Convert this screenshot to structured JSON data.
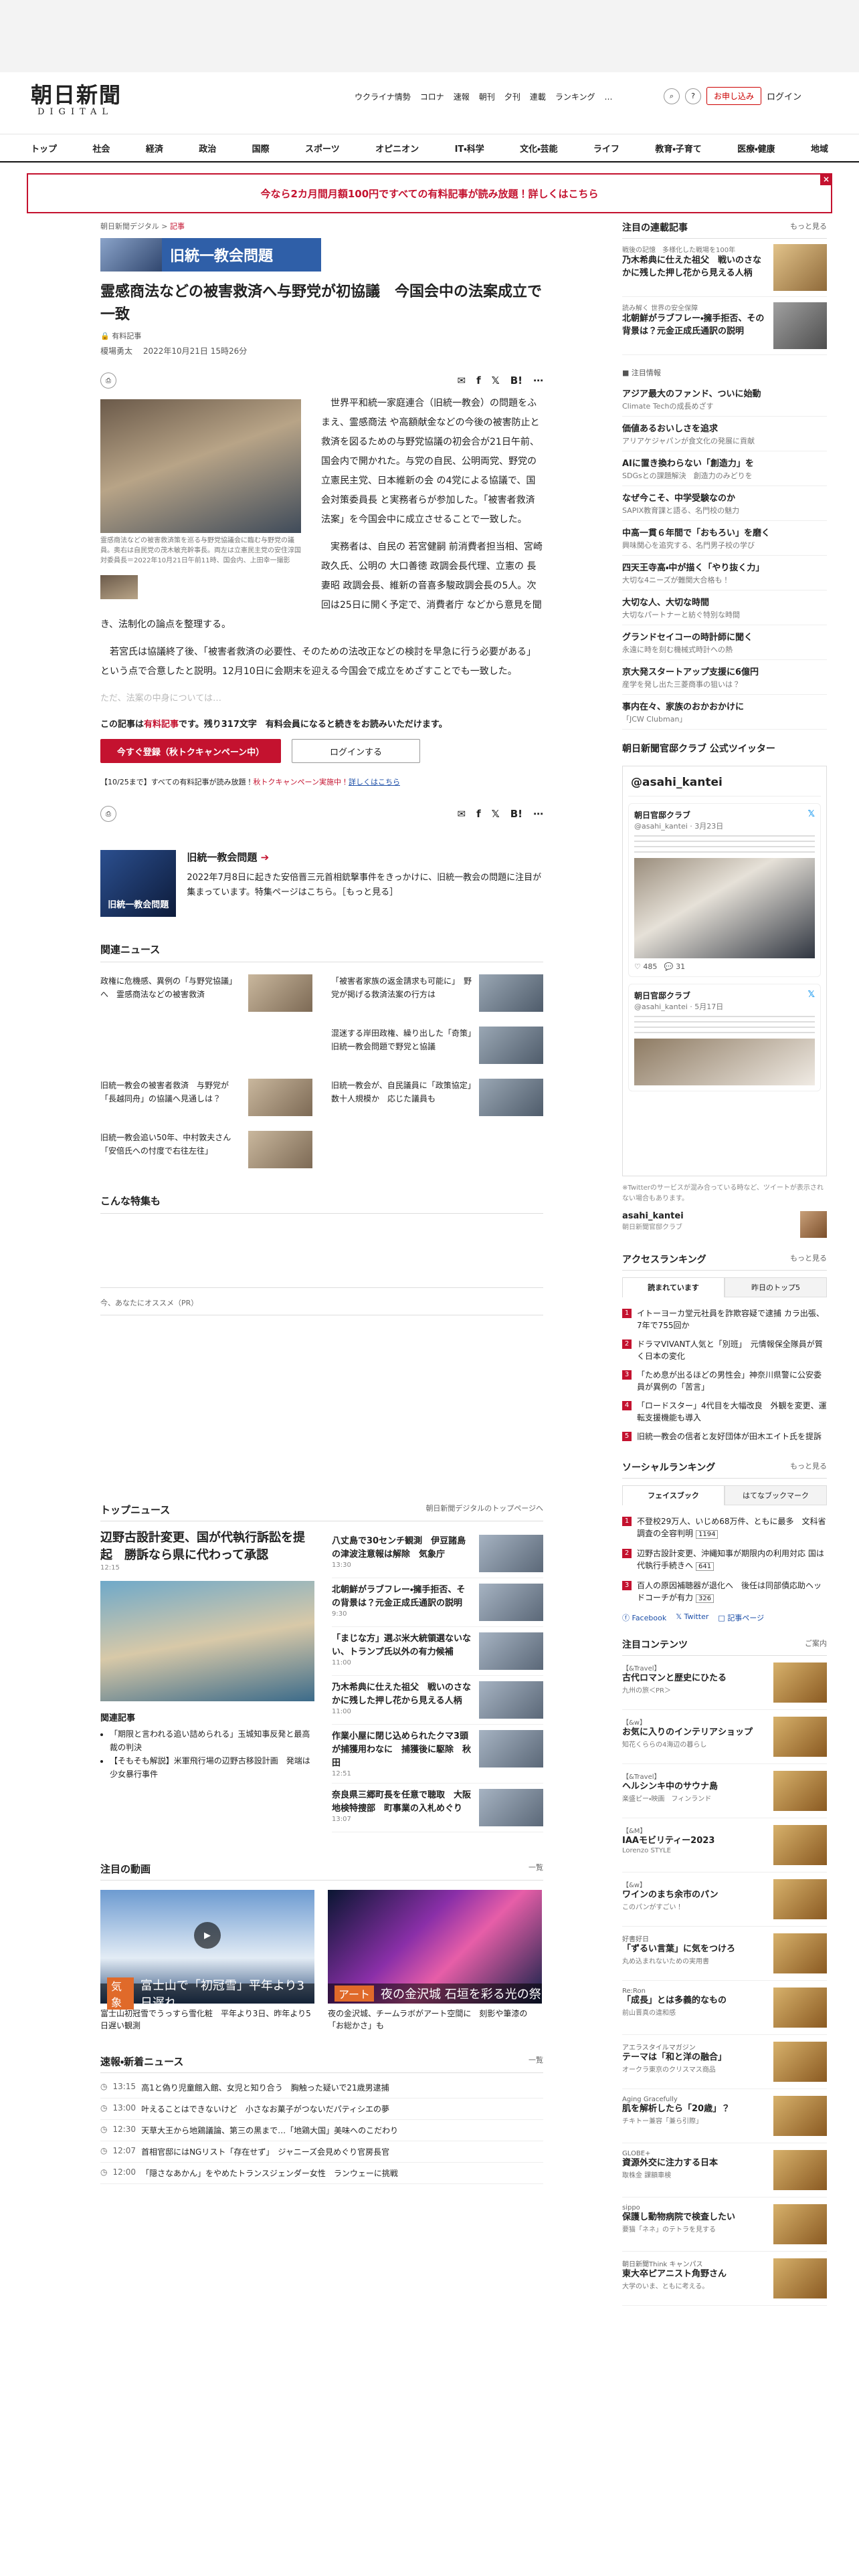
{
  "header": {
    "logo_main": "朝日新聞",
    "logo_sub": "DIGITAL",
    "nav": [
      "ウクライナ情勢",
      "コロナ",
      "速報",
      "朝刊",
      "夕刊",
      "連載",
      "ランキング",
      "…"
    ],
    "apply_label": "お申し込み",
    "login_label": "ログイン"
  },
  "categories": [
    "トップ",
    "社会",
    "経済",
    "政治",
    "国際",
    "スポーツ",
    "オピニオン",
    "IT・科学",
    "文化・芸能",
    "ライフ",
    "教育・子育て",
    "医療・健康",
    "地域"
  ],
  "banner": {
    "text": "今なら2カ月間月額100円ですべての有料記事が読み放題！詳しくはこちら",
    "close": "×"
  },
  "article": {
    "crumb1": "朝日新聞デジタル",
    "crumb_sep": ">",
    "crumb2": "記事",
    "series_badge": "旧統一教会問題",
    "title": "霊感商法などの被害救済へ与野党が初協議　今国会中の法案成立で一致",
    "paid": "有料記事",
    "author": "榎場勇太",
    "date": "2022年10月21日 15時26分",
    "list_label": "list",
    "photo_caption": "霊感商法などの被害救済策を巡る与野党協議会に臨む与野党の議員。奥右は自民党の茂木敏充幹事長。両左は立憲民主党の安住淳国対委員長＝2022年10月21日午前11時、国会内、上田幸一撮影",
    "p1": "世界平和統一家庭連合（旧統一教会）の問題をふまえ、霊感商法 や高額献金などの今後の被害防止と救済を図るための与野党協議の初会合が21日午前、国会内で開かれた。与党の自民、公明両党、野党の 立憲民主党、日本維新の会 の4党による協議で、国会対策委員長 と実務者らが参加した。「被害者救済法案」を今国会中に成立させることで一致した。",
    "p2": "実務者は、自民の 若宮健嗣 前消費者担当相、宮崎政久氏、公明の 大口善徳 政調会長代理、立憲の 長妻昭 政調会長、維新の音喜多駿政調会長の5人。次回は25日に開く予定で、消費者庁 などから意見を聞き、法制化の論点を整理する。",
    "p3": "若宮氏は協議終了後、「被害者救済の必要性、そのための法改正などの検討を早急に行う必要がある」という点で合意したと説明。12月10日に会期末を迎える今国会で成立をめざすことでも一致した。",
    "fade": "ただ、法案の中身については…",
    "rest_a": "この記事は",
    "rest_b": "有料記事",
    "rest_c": "です。残り317文字　有料会員になると続きをお読みいただけます。",
    "register_label": "今すぐ登録（秋トクキャンペーン中）",
    "login_label": "ログインする",
    "notice_a": "【10/25まで】すべての有料記事が読み放題！",
    "notice_b": "秋トクキャンペーン実施中！",
    "notice_c": "詳しくはこちら",
    "series_img_label": "旧統一教会問題",
    "series_title": "旧統一教会問題",
    "series_desc": "2022年7月8日に起きた安倍晋三元首相銃撃事件をきっかけに、旧統一教会の問題に注目が集まっています。特集ページはこちら。［もっと見る］"
  },
  "related": {
    "title": "関連ニュース",
    "items": [
      "政権に危機感、異例の「与野党協議」へ　霊感商法などの被害救済",
      "「被害者家族の返金請求も可能に」　野党が掲げる救済法案の行方は",
      "",
      "混迷する岸田政権、繰り出した「奇策」　旧統一教会問題で野党と協議",
      "旧統一教会の被害者救済　与野党が「長越同舟」の協議へ見通しは？",
      "旧統一教会が、自民議員に「政策協定」　数十人規模か　応じた議員も",
      "旧統一教会追い50年、中村敦夫さん「安倍氏への忖度で右往左往」"
    ]
  },
  "special": {
    "title": "こんな特集も",
    "pr": "今、あなたにオススメ（PR）"
  },
  "top_news": {
    "title": "トップニュース",
    "more": "朝日新聞デジタルのトップページへ",
    "lead": "辺野古設計変更、国が代執行訴訟を提起　勝訴なら県に代わって承認",
    "lead_time": "12:15",
    "rel_title": "関連記事",
    "rel": [
      "「期限と言われる追い詰められる」玉城知事反発と最高裁の判決",
      "【そもそも解説】米軍飛行場の辺野古移設計画　発端は少女暴行事件"
    ],
    "items": [
      {
        "t": "八丈島で30センチ観測　伊豆諸島の津波注意報は解除　気象庁",
        "tm": "13:30"
      },
      {
        "t": "北朝鮮がラブフレー・擁手拒否、その背景は？元金正成氏通訳の説明",
        "tm": "9:30"
      },
      {
        "t": "「まじな方」選ぶ米大統領選ないない、トランプ氏以外の有力候補",
        "tm": "11:00"
      },
      {
        "t": "乃木希典に仕えた祖父　戦いのさなかに残した押し花から見える人柄",
        "tm": "11:00"
      },
      {
        "t": "作業小屋に閉じ込められたクマ3頭が捕獲用わなに　捕獲後に駆除　秋田",
        "tm": "12:51"
      },
      {
        "t": "奈良県三郷町長を任意で聴取　大阪地検特捜部　町事業の入札めぐり",
        "tm": "13:07"
      }
    ]
  },
  "video": {
    "title": "注目の動画",
    "more": "一覧",
    "items": [
      {
        "tag": "気象",
        "ov": "富士山で「初冠雪」平年より3日遅れ",
        "cap": "富士山初冠雪でうっすら雪化粧　平年より3日、昨年より5日遅い観測"
      },
      {
        "tag": "アート",
        "ov": "夜の金沢城 石垣を彩る光の祭",
        "cap": "夜の金沢城、チームラボがアート空間に　刻影や筆漆の「お総かさ」も"
      }
    ]
  },
  "breaking": {
    "title": "速報・新着ニュース",
    "more": "一覧",
    "items": [
      {
        "tm": "13:15",
        "t": "高1と偽り児童館入館、女児と知り合う　胸触った疑いで21歳男逮捕"
      },
      {
        "tm": "13:00",
        "t": "叶えることはできないけど　小さなお菓子がつないだパティシエの夢"
      },
      {
        "tm": "12:30",
        "t": "天草大王から地鶏議論、第三の黒まで…「地鶏大国」美味へのこだわり"
      },
      {
        "tm": "12:07",
        "t": "首相官邸にはNGリスト「存在せず」　ジャニーズ会見めぐり官房長官"
      },
      {
        "tm": "12:00",
        "t": "「隠さなあかん」をやめたトランスジェンダー女性　ランウェーに挑戦"
      }
    ]
  },
  "side": {
    "series_title": "注目の連載記事",
    "series_more": "もっと見る",
    "series": [
      {
        "k": "戦後の記憶　多様化した戦場を100年",
        "t": "乃木希典に仕えた祖父　戦いのさなかに残した押し花から見える人柄"
      },
      {
        "k": "読み解く 世界の安全保障",
        "t": "北朝鮮がラブフレー・擁手拒否、その背景は？元金正成氏通訳の説明"
      }
    ],
    "notice_title": "注目情報",
    "notice": [
      {
        "t": "アジア最大のファンド、ついに始動",
        "s": "Climate Techの成長めざす"
      },
      {
        "t": "価値あるおいしさを追求",
        "s": "アリアケジャパンが食文化の発展に貢献"
      },
      {
        "t": "AIに置き換わらない「創造力」を",
        "s": "SDGsとの課題解決　創造力のみどりを"
      },
      {
        "t": "なぜ今こそ、中学受験なのか",
        "s": "SAPIX教育課と語る、名門校の魅力"
      },
      {
        "t": "中高一貫６年間で「おもろい」を磨く",
        "s": "興味関心を追究する、名門男子校の学び"
      },
      {
        "t": "四天王寺高・中が描く「やり抜く力」",
        "s": "大切な4ニーズが難関大合格も！"
      },
      {
        "t": "大切な人、大切な時間",
        "s": "大切なパートナーと紡ぐ特別な時間"
      },
      {
        "t": "グランドセイコーの時計師に聞く",
        "s": "永遠に時を刻む機械式時計への熱"
      },
      {
        "t": "京大発スタートアップ支援に6億円",
        "s": "産学を発し出た三菱商事の狙いは？"
      },
      {
        "t": "事内在々、家族のおかおかけに",
        "s": "「JCW Clubman」"
      }
    ],
    "club_title": "朝日新聞官邸クラブ 公式ツイッター",
    "tw_head": "@asahi_kantei",
    "tw_name": "朝日官邸クラブ",
    "tw1_id": "@asahi_kantei · 3月23日",
    "tw1_likes": "485",
    "tw1_reply": "31",
    "tw2_id": "@asahi_kantei · 5月17日",
    "tw_note": "※Twitterのサービスが混み合っている時など、ツイートが表示されない場合もあります。",
    "acct_name": "asahi_kantei",
    "acct_sub": "朝日新聞官邸クラブ",
    "access_title": "アクセスランキング",
    "access_more": "もっと見る",
    "tab_on": "読まれています",
    "tab_off": "昨日のトップ5",
    "access": [
      "イトーヨーカ堂元社員を詐欺容疑で逮捕 カラ出張、7年で755回か",
      "ドラマVIVANT人気と「別班」　元情報保全隊員が質く日本の変化",
      "「ため息が出るほどの男性会」神奈川県警に公安委員が異例の「苦言」",
      "「ロードスター」4代目を大幅改良　外観を変更、運転支援機能も導入",
      "旧統一教会の信者と友好団体が田木エイト氏を提訴"
    ],
    "social_title": "ソーシャルランキング",
    "social_more": "もっと見る",
    "stab_on": "フェイスブック",
    "stab_off": "はてなブックマーク",
    "social": [
      {
        "t": "不登校29万人、いじめ68万件、ともに最多　文科省調査の全容判明",
        "c": "1194"
      },
      {
        "t": "辺野古設計変更、沖縄知事が期限内の利用対応 国は代執行手続きへ",
        "c": "641"
      },
      {
        "t": "百人の原因補聴器が退化へ　後任は同部債応助ヘッドコーチが有力",
        "c": "326"
      }
    ],
    "share_fb": "Facebook",
    "share_tw": "Twitter",
    "share_mail": "記事ページ",
    "content_title": "注目コンテンツ",
    "content_more": "ご案内",
    "contents": [
      {
        "k": "【&Travel】",
        "t": "古代ロマンと歴史にひたる",
        "s": "九州の旅＜PR＞"
      },
      {
        "k": "【&w】",
        "t": "お気に入りのインテリアショップ",
        "s": "知花くららの4海辺の暮らし"
      },
      {
        "k": "【&Travel】",
        "t": "ヘルシンキ中のサウナ島",
        "s": "楽盛ピー・映画　フィンランド"
      },
      {
        "k": "【&M】",
        "t": "IAAモビリティー2023",
        "s": "Lorenzo STYLE"
      },
      {
        "k": "【&w】",
        "t": "ワインのまち余市のパン",
        "s": "このパンがすごい！"
      },
      {
        "k": "好書好日",
        "t": "「ずるい言葉」に気をつけろ",
        "s": "丸め込まれないための実用書"
      },
      {
        "k": "Re:Ron",
        "t": "「成長」とは多義的なもの",
        "s": "前山晋真の違和感"
      },
      {
        "k": "アエラスタイルマガジン",
        "t": "テーマは「和と洋の融合」",
        "s": "オークラ東京のクリスマス商品"
      },
      {
        "k": "Aging Gracefully",
        "t": "肌を解析したら「20歳」？",
        "s": "チキトー兼容「兼ら引際」"
      },
      {
        "k": "GLOBE+",
        "t": "資源外交に注力する日本",
        "s": "取株金 課額車検"
      },
      {
        "k": "sippo",
        "t": "保護し動物病院で検査したい",
        "s": "要猫「ネネ」のテトラを見する"
      },
      {
        "k": "朝日新聞Think キャンパス",
        "t": "東大卒ピアニスト角野さん",
        "s": "大学のいま、ともに考える。"
      }
    ]
  }
}
